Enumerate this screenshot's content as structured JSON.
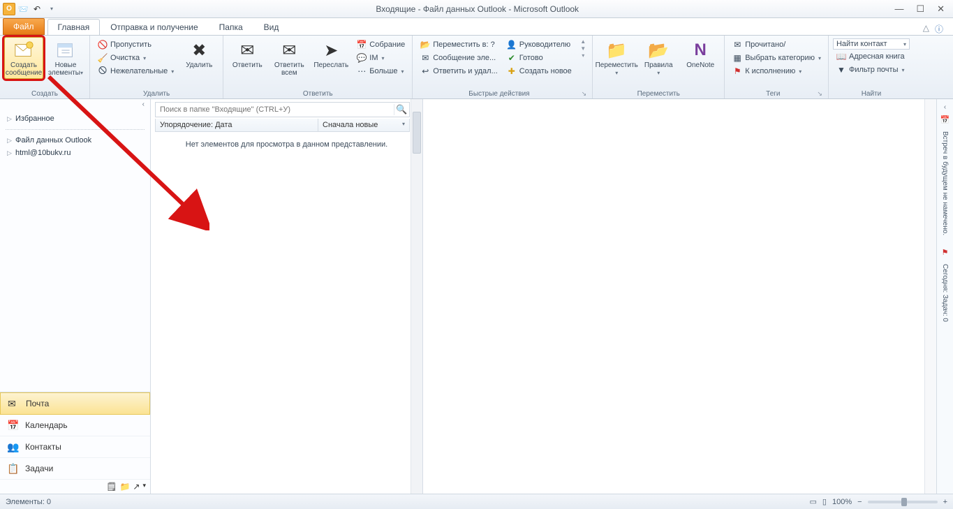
{
  "titlebar": {
    "title": "Входящие - Файл данных Outlook  -  Microsoft Outlook"
  },
  "tabs": {
    "file": "Файл",
    "items": [
      "Главная",
      "Отправка и получение",
      "Папка",
      "Вид"
    ],
    "active": 0
  },
  "ribbon": {
    "new": {
      "create_msg_l1": "Создать",
      "create_msg_l2": "сообщение",
      "new_items_l1": "Новые",
      "new_items_l2": "элементы",
      "group": "Создать"
    },
    "delete": {
      "ignore": "Пропустить",
      "cleanup": "Очистка",
      "junk": "Нежелательные",
      "delete": "Удалить",
      "group": "Удалить"
    },
    "respond": {
      "reply": "Ответить",
      "reply_all_l1": "Ответить",
      "reply_all_l2": "всем",
      "forward": "Переслать",
      "meeting": "Собрание",
      "im": "IM",
      "more": "Больше",
      "group": "Ответить"
    },
    "quick": {
      "items": [
        "Переместить в: ?",
        "Руководителю",
        "Сообщение эле...",
        "Готово",
        "Ответить и удал...",
        "Создать новое"
      ],
      "group": "Быстрые действия"
    },
    "move": {
      "move": "Переместить",
      "rules": "Правила",
      "onenote": "OneNote",
      "group": "Переместить"
    },
    "tags": {
      "read": "Прочитано/",
      "cat": "Выбрать категорию",
      "follow": "К исполнению",
      "group": "Теги"
    },
    "find": {
      "find_contact": "Найти контакт",
      "address": "Адресная книга",
      "filter": "Фильтр почты",
      "group": "Найти"
    }
  },
  "nav": {
    "favorites": "Избранное",
    "datafile": "Файл данных Outlook",
    "account": "html@10bukv.ru",
    "buttons": {
      "mail": "Почта",
      "calendar": "Календарь",
      "contacts": "Контакты",
      "tasks": "Задачи"
    }
  },
  "list": {
    "search_placeholder": "Поиск в папке \"Входящие\" (CTRL+У)",
    "sort_by": "Упорядочение: Дата",
    "sort_dir": "Сначала новые",
    "empty": "Нет элементов для просмотра в данном представлении."
  },
  "todobar": {
    "appt": "Встреч в будущем не намечено.",
    "today": "Сегодня: Задач: 0"
  },
  "status": {
    "items": "Элементы: 0",
    "zoom": "100%"
  }
}
